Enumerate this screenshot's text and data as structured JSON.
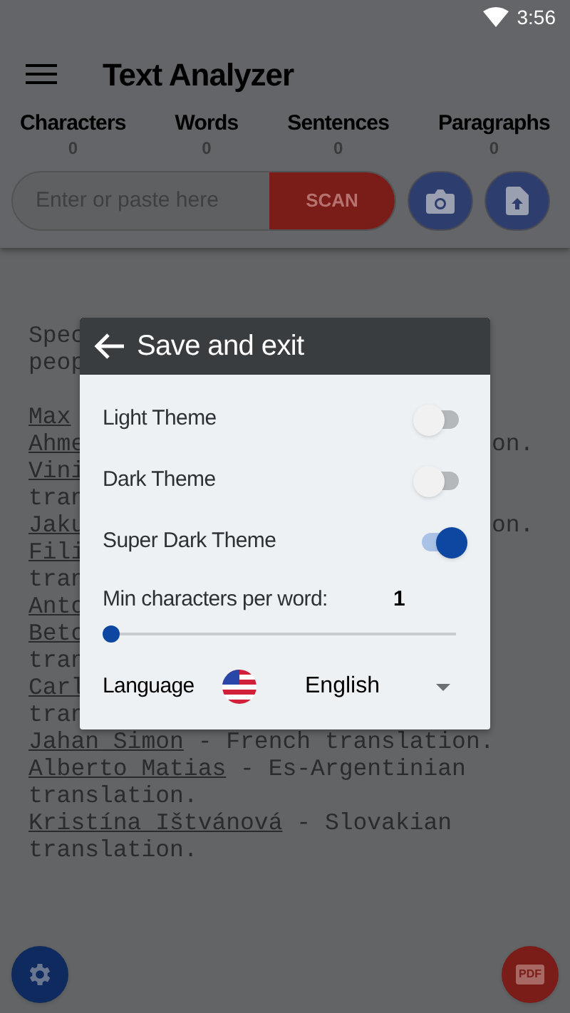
{
  "status_bar": {
    "time": "3:56"
  },
  "app_bar": {
    "title": "Text Analyzer"
  },
  "stats": [
    {
      "label": "Characters",
      "value": "0"
    },
    {
      "label": "Words",
      "value": "0"
    },
    {
      "label": "Sentences",
      "value": "0"
    },
    {
      "label": "Paragraphs",
      "value": "0"
    }
  ],
  "input": {
    "placeholder": "Enter or paste here",
    "scan_button": "SCAN"
  },
  "background_text": [
    {
      "lines": [
        {
          "text": "Spec"
        },
        {
          "text": "peop"
        }
      ]
    },
    {
      "lines": [
        {
          "link": "Max"
        },
        {
          "link": "Ahme",
          "tail": "on."
        },
        {
          "link": "Vini"
        },
        {
          "text": "tran"
        },
        {
          "link": "Jaku",
          "tail": "on."
        },
        {
          "link": "Fili"
        },
        {
          "text": "tran"
        },
        {
          "link": "Anto"
        },
        {
          "link": "Beto"
        },
        {
          "text": "tran"
        },
        {
          "link": "Carl"
        },
        {
          "text": "tran"
        },
        {
          "link": "Jahan Simon",
          "text": " - French translation."
        },
        {
          "link": "Alberto Matias",
          "text": " - Es-Argentinian"
        },
        {
          "text": "translation."
        },
        {
          "link": "Kristína Ištvánová",
          "text": " - Slovakian"
        },
        {
          "text": "translation."
        }
      ]
    }
  ],
  "dialog": {
    "title": "Save and exit",
    "toggles": [
      {
        "label": "Light Theme",
        "on": false
      },
      {
        "label": "Dark Theme",
        "on": false
      },
      {
        "label": "Super Dark Theme",
        "on": true
      }
    ],
    "min_chars": {
      "label": "Min characters per word:",
      "value": "1",
      "level": 0
    },
    "language": {
      "label": "Language",
      "value": "English"
    }
  },
  "pdf_button": {
    "label": "PDF"
  }
}
